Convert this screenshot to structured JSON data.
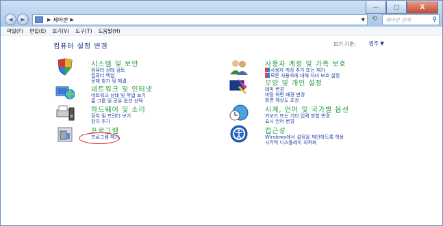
{
  "window": {
    "buttons": {
      "minimize": "—",
      "maximize": "□",
      "close": "X"
    }
  },
  "nav": {
    "back": "◀",
    "forward": "▶",
    "breadcrumb": [
      "제어판"
    ],
    "search_placeholder": "제어판 검색"
  },
  "menu": [
    "파일(F)",
    "편집(E)",
    "보기(V)",
    "도구(T)",
    "도움말(H)"
  ],
  "main": {
    "heading": "컴퓨터 설정 변경",
    "view_by_label": "보기 기준:",
    "view_by_value": "범주 ▼"
  },
  "categories_left": [
    {
      "title": "시스템 및 보안",
      "links": [
        "컴퓨터 상태 검토",
        "컴퓨터 백업",
        "문제 찾기 및 해결"
      ],
      "icon": "shield-computer-icon"
    },
    {
      "title": "네트워크 및 인터넷",
      "links": [
        "네트워크 상태 및 작업 보기",
        "홈 그룹 및 공유 옵션 선택"
      ],
      "icon": "network-globe-icon"
    },
    {
      "title": "하드웨어 및 소리",
      "links": [
        "장치 및 프린터 보기",
        "장치 추가"
      ],
      "icon": "printer-speaker-icon"
    },
    {
      "title": "프로그램",
      "links": [
        "프로그램 제거"
      ],
      "icon": "programs-box-icon"
    }
  ],
  "categories_right": [
    {
      "title": "사용자 계정 및 가족 보호",
      "links": [
        "사용자 계정 추가 또는 제거",
        "모든 사용자에 대해 자녀 보호 설정"
      ],
      "icon": "users-icon"
    },
    {
      "title": "모양 및 개인 설정",
      "links": [
        "테마 변경",
        "바탕 화면 배경 변경",
        "화면 해상도 조정"
      ],
      "icon": "appearance-icon"
    },
    {
      "title": "시계, 언어 및 국가별 옵션",
      "links": [
        "키보드 또는 기타 입력 방법 변경",
        "표시 언어 변경"
      ],
      "icon": "clock-globe-icon"
    },
    {
      "title": "접근성",
      "links": [
        "Windows에서 설정을 제안하도록 허용",
        "시각적 디스플레이 최적화"
      ],
      "icon": "accessibility-icon"
    }
  ]
}
